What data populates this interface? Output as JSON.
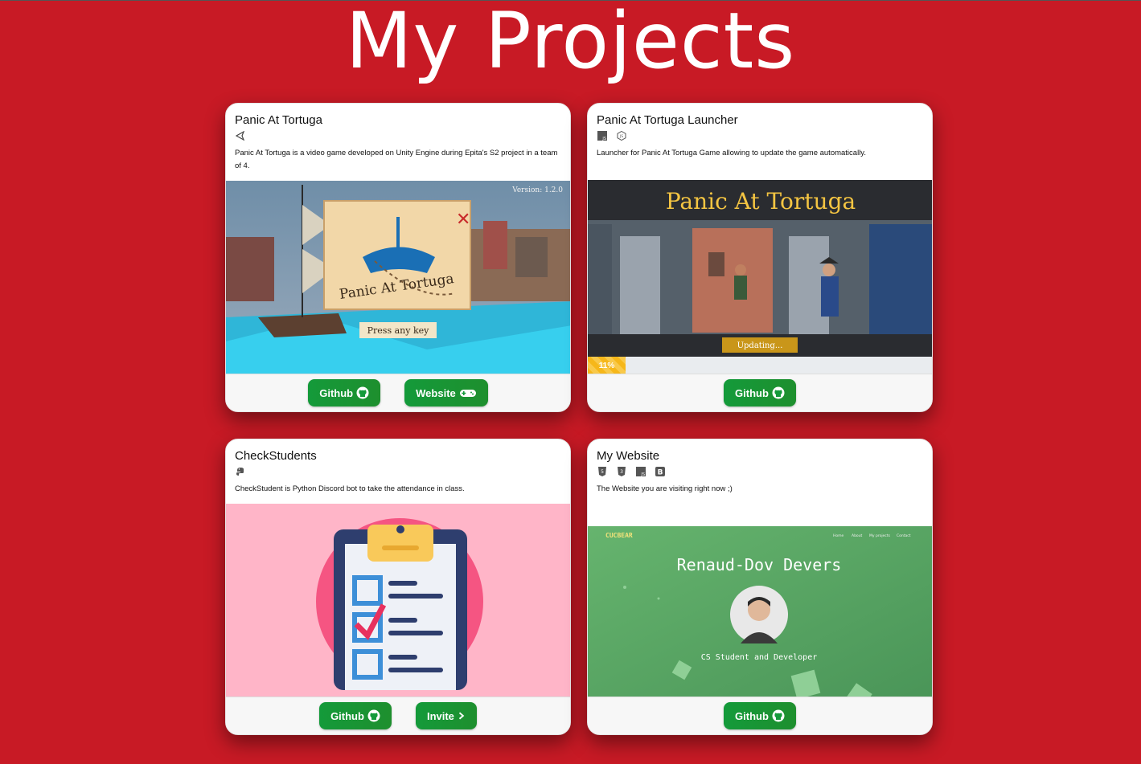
{
  "page": {
    "title": "My Projects"
  },
  "projects": [
    {
      "title": "Panic At Tortuga",
      "tech_icons": [
        "unity-icon"
      ],
      "description": "Panic At Tortuga is a video game developed on Unity Engine during Epita's S2 project in a team of 4.",
      "screenshot": {
        "version_text": "Version: 1.2.0",
        "logo_text": "Panic At Tortuga",
        "prompt_text": "Press any key"
      },
      "buttons": [
        {
          "label": "Github",
          "icon": "github-icon"
        },
        {
          "label": "Website",
          "icon": "gamepad-icon"
        }
      ]
    },
    {
      "title": "Panic At Tortuga Launcher",
      "tech_icons": [
        "javascript-icon",
        "nodejs-icon"
      ],
      "description": "Launcher for Panic At Tortuga Game allowing to update the game automatically.",
      "screenshot": {
        "banner_text": "Panic At Tortuga",
        "status_text": "Updating...",
        "progress_label": "11%",
        "progress": 0.11
      },
      "buttons": [
        {
          "label": "Github",
          "icon": "github-icon"
        }
      ]
    },
    {
      "title": "CheckStudents",
      "tech_icons": [
        "python-icon"
      ],
      "description": "CheckStudent is Python Discord bot to take the attendance in class.",
      "buttons": [
        {
          "label": "Github",
          "icon": "github-icon"
        },
        {
          "label": "Invite",
          "icon": "chevron-right-icon"
        }
      ]
    },
    {
      "title": "My Website",
      "tech_icons": [
        "html5-icon",
        "css3-icon",
        "javascript-icon",
        "bootstrap-icon"
      ],
      "description": "The Website you are visiting right now ;)",
      "screenshot": {
        "brand": "CUCBEAR",
        "nav": [
          "Home",
          "About",
          "My projects",
          "Contact"
        ],
        "heading": "Renaud-Dov Devers",
        "subheading": "CS Student and Developer"
      },
      "buttons": [
        {
          "label": "Github",
          "icon": "github-icon"
        }
      ]
    }
  ],
  "colors": {
    "background": "#c81a25",
    "button": "#149a3a",
    "progress": "#f6b71a"
  }
}
